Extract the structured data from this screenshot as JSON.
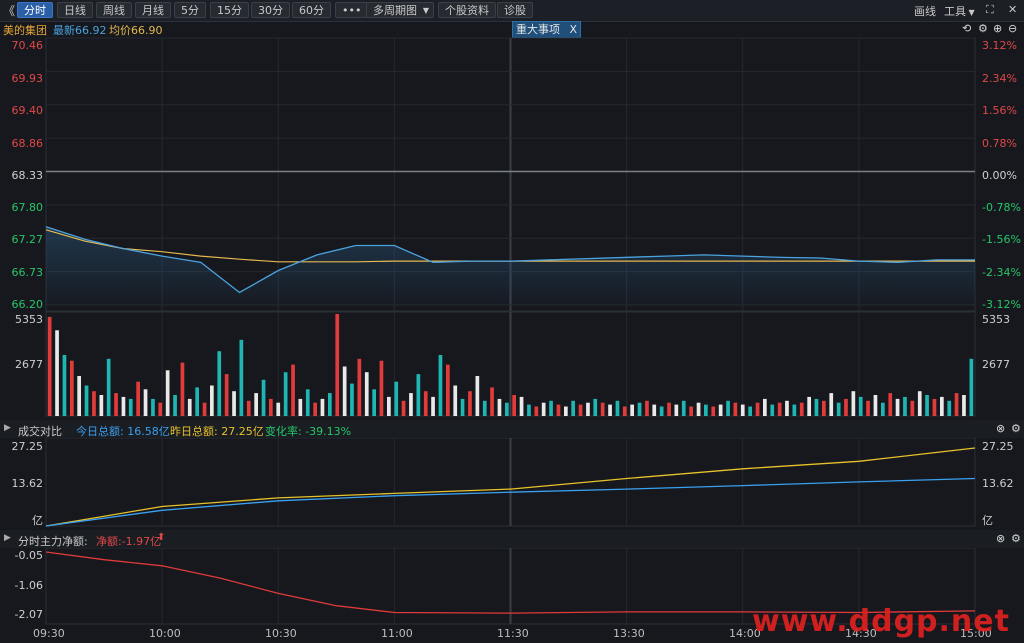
{
  "toolbar": {
    "back_glyph": "《",
    "tabs": [
      "分时",
      "日线",
      "周线",
      "月线",
      "5分",
      "15分",
      "30分",
      "60分",
      "•••"
    ],
    "multi_period": "多周期图",
    "stock_info": "个股资料",
    "diagnose": "诊股",
    "draw": "画线",
    "tools": "工具",
    "expand_glyph": "⛶",
    "close_glyph": "✕"
  },
  "header": {
    "stock_name": "美的集团",
    "latest": "最新66.92",
    "avg": "均价66.90",
    "event_button": "重大事项",
    "event_close": "X"
  },
  "price_panel": {
    "y_labels": [
      "70.46",
      "69.93",
      "69.40",
      "68.86",
      "68.33",
      "67.80",
      "67.27",
      "66.73",
      "66.20"
    ],
    "pct_labels": [
      "3.12%",
      "2.34%",
      "1.56%",
      "0.78%",
      "0.00%",
      "-0.78%",
      "-1.56%",
      "-2.34%",
      "-3.12%"
    ]
  },
  "volume_panel": {
    "y_labels": [
      "5353",
      "2677"
    ]
  },
  "turnover_panel": {
    "title": "成交对比",
    "today": "今日总额: 16.58亿",
    "yesterday": "昨日总额: 27.25亿",
    "change": "变化率: -39.13%",
    "y_labels": [
      "27.25",
      "13.62",
      "亿"
    ]
  },
  "flow_panel": {
    "title": "分时主力净额:",
    "net": "净额:-1.97亿",
    "y_labels": [
      "-0.05",
      "-1.06",
      "-2.07"
    ]
  },
  "time_labels": [
    "09:30",
    "10:00",
    "10:30",
    "11:00",
    "11:30",
    "13:30",
    "14:00",
    "14:30",
    "15:00"
  ],
  "watermark": "www.ddgp.net",
  "colors": {
    "price_line": "#4aa3e0",
    "avg_line": "#e5b84f",
    "up": "#e23b3b",
    "down": "#1fb5b3",
    "white_bar": "#e9e9e9",
    "today_line": "#3aa0f0",
    "yesterday_line": "#e8c22a",
    "flow_line": "#e03a3a",
    "watermark": "#e02020"
  },
  "chart_data": [
    {
      "type": "line",
      "title": "美的集团",
      "x": [
        "09:30",
        "09:40",
        "09:50",
        "10:00",
        "10:10",
        "10:20",
        "10:30",
        "10:40",
        "10:50",
        "11:00",
        "11:10",
        "11:20",
        "11:30",
        "13:40",
        "13:50",
        "14:00",
        "14:10",
        "14:20",
        "14:30",
        "14:40",
        "14:50",
        "15:00"
      ],
      "series": [
        {
          "name": "最新",
          "values": [
            67.45,
            67.25,
            67.1,
            66.98,
            66.88,
            66.4,
            66.75,
            67.0,
            67.15,
            67.15,
            66.88,
            66.9,
            66.9,
            66.98,
            67.0,
            66.98,
            66.96,
            66.95,
            66.9,
            66.88,
            66.92,
            66.92
          ]
        },
        {
          "name": "均价",
          "values": [
            67.4,
            67.22,
            67.1,
            67.05,
            66.98,
            66.93,
            66.89,
            66.89,
            66.89,
            66.9,
            66.9,
            66.9,
            66.9,
            66.9,
            66.9,
            66.9,
            66.9,
            66.9,
            66.9,
            66.9,
            66.9,
            66.9
          ]
        }
      ],
      "ylim": [
        66.2,
        70.46
      ],
      "prev_close": 68.33
    },
    {
      "type": "bar",
      "title": "",
      "x_range": [
        "09:30",
        "15:00"
      ],
      "ylim": [
        0,
        5353
      ],
      "values": [
        5200,
        4500,
        3200,
        2900,
        2100,
        1600,
        1300,
        1100,
        3000,
        1200,
        1000,
        900,
        1800,
        1400,
        900,
        700,
        2400,
        1100,
        2800,
        900,
        1500,
        700,
        1600,
        3400,
        2200,
        1300,
        4000,
        800,
        1200,
        1900,
        900,
        700,
        2300,
        2700,
        900,
        1400,
        700,
        900,
        1200,
        5353,
        2600,
        1700,
        3000,
        2300,
        1400,
        2900,
        1000,
        1800,
        800,
        1200,
        2200,
        1300,
        1000,
        3200,
        2700,
        1600,
        900,
        1300,
        2100,
        800,
        1500,
        900,
        700,
        1100,
        1000,
        600,
        500,
        700,
        800,
        600,
        500,
        800,
        600,
        700,
        900,
        700,
        600,
        800,
        500,
        600,
        700,
        800,
        600,
        500,
        700,
        600,
        800,
        500,
        700,
        600,
        500,
        600,
        800,
        700,
        600,
        500,
        700,
        900,
        600,
        700,
        800,
        600,
        700,
        1000,
        900,
        800,
        1200,
        700,
        900,
        1300,
        1000,
        800,
        1100,
        700,
        1200,
        900,
        1000,
        800,
        1300,
        1100,
        900,
        1000,
        800,
        1200,
        1100,
        3000
      ]
    },
    {
      "type": "line",
      "title": "成交对比",
      "x": [
        "09:30",
        "10:00",
        "10:30",
        "11:00",
        "11:30",
        "13:30",
        "14:00",
        "14:30",
        "15:00"
      ],
      "series": [
        {
          "name": "今日总额",
          "values": [
            0,
            5.5,
            8.8,
            10.6,
            11.8,
            12.9,
            14.1,
            15.4,
            16.58
          ]
        },
        {
          "name": "昨日总额",
          "values": [
            0,
            6.8,
            9.8,
            11.4,
            12.9,
            16.6,
            20.0,
            22.6,
            27.25
          ]
        }
      ],
      "ylim": [
        0,
        27.25
      ],
      "ylabel": "亿"
    },
    {
      "type": "line",
      "title": "分时主力净额:",
      "x": [
        "09:30",
        "09:45",
        "10:00",
        "10:15",
        "10:30",
        "10:45",
        "11:00",
        "11:30",
        "13:30",
        "14:00",
        "14:30",
        "15:00"
      ],
      "series": [
        {
          "name": "净额",
          "values": [
            -0.05,
            -0.3,
            -0.5,
            -0.9,
            -1.4,
            -1.8,
            -2.02,
            -2.04,
            -2.0,
            -2.0,
            -2.02,
            -1.97
          ]
        }
      ],
      "ylim": [
        -2.07,
        -0.05
      ]
    }
  ]
}
